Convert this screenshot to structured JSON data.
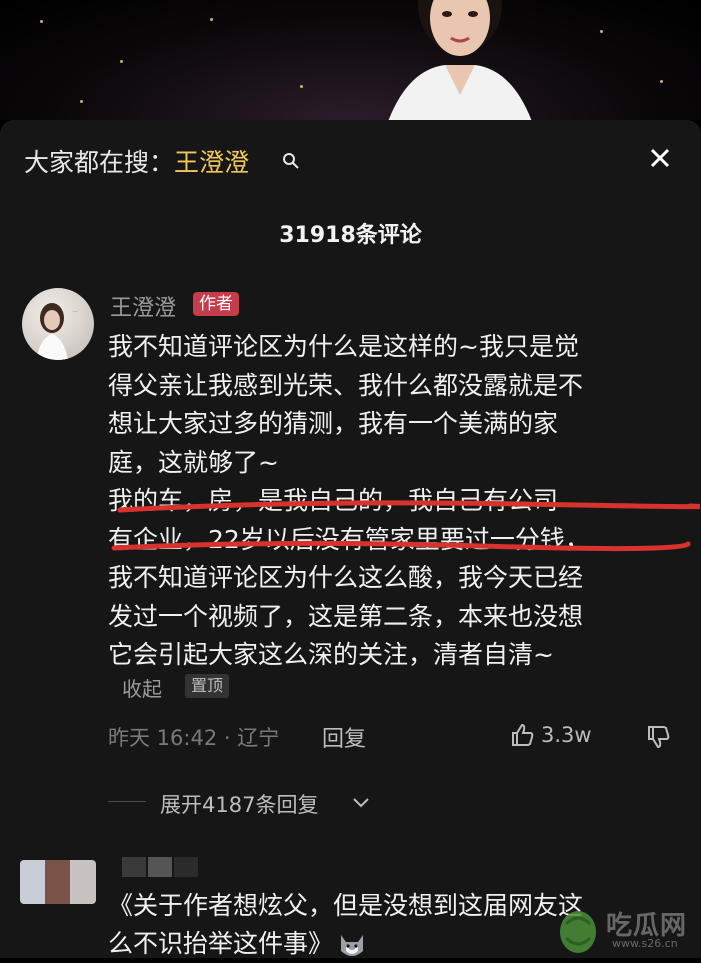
{
  "search_hint": {
    "prefix": "大家都在搜：",
    "keyword": "王澄澄"
  },
  "comments_header": {
    "count_text": "31918条评论"
  },
  "pinned_comment": {
    "author": "王澄澄",
    "author_tag": "作者",
    "lines": [
      "我不知道评论区为什么是这样的~我只是觉",
      "得父亲让我感到光荣、我什么都没露就是不",
      "想让大家过多的猜测，我有一个美满的家",
      "庭，这就够了~",
      "我的车，房，是我自己的，我自己有公司",
      "有企业，22岁以后没有管家里要过一分钱，",
      "我不知道评论区为什么这么酸，我今天已经",
      "发过一个视频了，这是第二条，本来也没想",
      "它会引起大家这么深的关注，清者自清~"
    ],
    "collapse_label": "收起",
    "pin_label": "置顶",
    "time_location": "昨天 16:42 · 辽宁",
    "reply_label": "回复",
    "like_count": "3.3w",
    "expand_replies": "展开4187条回复"
  },
  "next_comment": {
    "lines": [
      "《关于作者想炫父，但是没想到这届网友这",
      "么不识抬举这件事》"
    ]
  },
  "watermark": {
    "text": "吃瓜网",
    "url": "www.s26.cn"
  },
  "colors": {
    "keyword": "#f1c757",
    "author_tag_bg": "#c53d4b",
    "underline": "#d8322c"
  }
}
